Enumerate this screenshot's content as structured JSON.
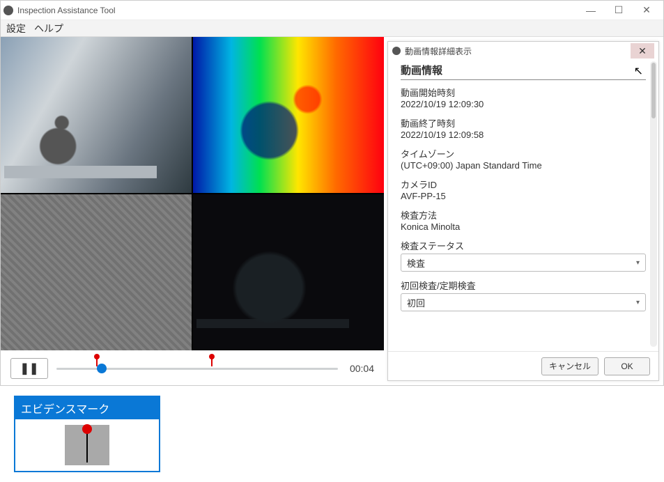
{
  "window": {
    "title": "Inspection Assistance Tool"
  },
  "menubar": {
    "settings": "設定",
    "help": "ヘルプ"
  },
  "player": {
    "time": "00:04",
    "playhead_pct": 16,
    "marks_pct": [
      14,
      55
    ]
  },
  "panel": {
    "window_title": "動画情報詳細表示",
    "heading": "動画情報",
    "fields": {
      "start": {
        "label": "動画開始時刻",
        "value": "2022/10/19 12:09:30"
      },
      "end": {
        "label": "動画終了時刻",
        "value": "2022/10/19 12:09:58"
      },
      "timezone": {
        "label": "タイムゾーン",
        "value": "(UTC+09:00) Japan Standard Time"
      },
      "camera": {
        "label": "カメラID",
        "value": "AVF-PP-15"
      },
      "method": {
        "label": "検査方法",
        "value": "Konica Minolta"
      },
      "status": {
        "label": "検査ステータス",
        "selected": "検査"
      },
      "type": {
        "label": "初回検査/定期検査",
        "selected": "初回"
      }
    },
    "buttons": {
      "cancel": "キャンセル",
      "ok": "OK"
    }
  },
  "legend": {
    "title": "エビデンスマーク"
  }
}
